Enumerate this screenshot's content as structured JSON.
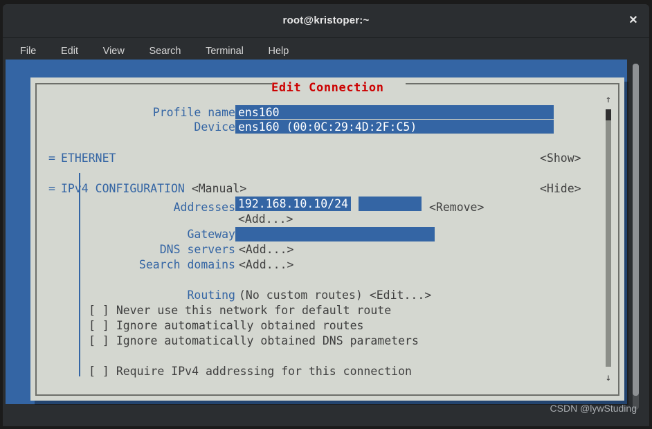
{
  "window": {
    "title": "root@kristoper:~",
    "close_icon": "✕",
    "menu": [
      "File",
      "Edit",
      "View",
      "Search",
      "Terminal",
      "Help"
    ]
  },
  "dialog": {
    "title": "Edit Connection",
    "title_color": "#cc0000",
    "background": "#d4d7d0",
    "accent_blue": "#3465a4"
  },
  "form": {
    "profile_name_label": "Profile name",
    "profile_name_value": "ens160",
    "device_label": "Device",
    "device_value": "ens160 (00:0C:29:4D:2F:C5)",
    "ethernet_marker": "=",
    "ethernet_label": "ETHERNET",
    "ethernet_toggle": "<Show>",
    "ipv4_marker": "=",
    "ipv4_label": "IPv4 CONFIGURATION",
    "ipv4_mode": "<Manual>",
    "ipv4_toggle": "<Hide>",
    "addresses_label": "Addresses",
    "addresses_value": "192.168.10.10/24",
    "addresses_remove": "<Remove>",
    "addresses_add": "<Add...>",
    "gateway_label": "Gateway",
    "gateway_value": "",
    "dns_label": "DNS servers",
    "dns_add": "<Add...>",
    "search_label": "Search domains",
    "search_add": "<Add...>",
    "routing_label": "Routing",
    "routing_status": "(No custom routes)",
    "routing_edit": "<Edit...>",
    "checkbox_unchecked": "[ ]",
    "check_never_default": "Never use this network for default route",
    "check_ignore_routes": "Ignore automatically obtained routes",
    "check_ignore_dns": "Ignore automatically obtained DNS parameters",
    "check_require_ipv4": "Require IPv4 addressing for this connection"
  },
  "scroll": {
    "up_arrow": "↑",
    "down_arrow": "↓"
  },
  "watermark": "CSDN @lywStuding"
}
